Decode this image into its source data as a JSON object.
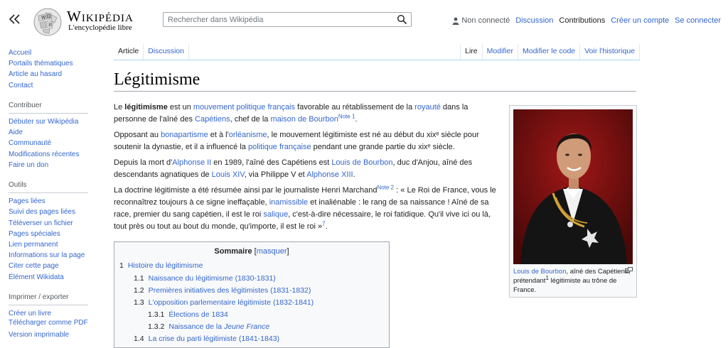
{
  "header": {
    "logo_wordmark": "Wikipédia",
    "logo_tagline": "L'encyclopédie libre",
    "search_placeholder": "Rechercher dans Wikipédia",
    "user_links": [
      "Non connecté",
      "Discussion",
      "Contributions",
      "Créer un compte",
      "Se connecter"
    ]
  },
  "sidebar": {
    "nav": [
      "Accueil",
      "Portails thématiques",
      "Article au hasard",
      "Contact"
    ],
    "sections": [
      {
        "heading": "Contribuer",
        "items": [
          "Débuter sur Wikipédia",
          "Aide",
          "Communauté",
          "Modifications récentes",
          "Faire un don"
        ]
      },
      {
        "heading": "Outils",
        "items": [
          "Pages liées",
          "Suivi des pages liées",
          "Téléverser un fichier",
          "Pages spéciales",
          "Lien permanent",
          "Informations sur la page",
          "Citer cette page",
          "Élément Wikidata"
        ]
      },
      {
        "heading": "Imprimer / exporter",
        "items": [
          "Créer un livre",
          "Télécharger comme PDF",
          "Version imprimable"
        ]
      }
    ]
  },
  "tabs": {
    "left": [
      "Article",
      "Discussion"
    ],
    "right": [
      "Lire",
      "Modifier",
      "Modifier le code",
      "Voir l'historique"
    ]
  },
  "article": {
    "title": "Légitimisme",
    "p1": {
      "t0": "Le ",
      "b": "légitimisme",
      "t1": " est un ",
      "l1": "mouvement politique",
      "t2": " ",
      "l2": "français",
      "t3": " favorable au rétablissement de la ",
      "l3": "royauté",
      "t4": " dans la personne de l'aîné des ",
      "l4": "Capétiens",
      "t5": ", chef de la ",
      "l5": "maison de Bourbon",
      "n": "Note 1",
      "t6": "."
    },
    "p2": {
      "t0": "Opposant au ",
      "l1": "bonapartisme",
      "t1": " et à l'",
      "l2": "orléanisme",
      "t2": ", le mouvement légitimiste est né au début du xixᵉ siècle pour soutenir la dynastie, et il a influencé la ",
      "l3": "politique française",
      "t3": " pendant une grande partie du xixᵉ siècle."
    },
    "p3": {
      "t0": "Depuis la mort d'",
      "l1": "Alphonse II",
      "t1": " en 1989, l'aîné des Capétiens est ",
      "l2": "Louis de Bourbon",
      "t2": ", duc d'Anjou, aîné des descendants agnatiques de ",
      "l3": "Louis XIV",
      "t3": ", via Philippe V et ",
      "l4": "Alphonse XIII",
      "t4": "."
    },
    "p4": {
      "t0": "La doctrine légitimiste a été résumée ainsi par le journaliste Henri Marchand",
      "n": "Note 2",
      "t1": " : « Le Roi de France, vous le reconnaîtrez toujours à ce signe ineffaçable, ",
      "l1": "inamissible",
      "t2": " et inaliénable : le rang de sa naissance ! Aîné de sa race, premier du sang capétien, il est le roi ",
      "l2": "salique",
      "t3": ", c'est-à-dire nécessaire, le roi fatidique. Qu'il vive ici ou là, tout près ou tout au bout du monde, qu'importe, il est le roi »",
      "r": "7",
      "t4": "."
    }
  },
  "infobox": {
    "caption_link": "Louis de Bourbon",
    "caption_t1": ", aîné des Capétiens, prétendant",
    "caption_sup": "1",
    "caption_t2": " légitimiste au trône de France."
  },
  "toc": {
    "title": "Sommaire",
    "toggle": "masquer",
    "entries": [
      {
        "num": "1",
        "text": "Histoire du légitimisme"
      },
      {
        "num": "1.1",
        "text": "Naissance du légitimisme (1830-1831)"
      },
      {
        "num": "1.2",
        "text": "Premières initiatives des légitimistes (1831-1832)"
      },
      {
        "num": "1.3",
        "text": "L'opposition parlementaire légitimiste (1832-1841)"
      },
      {
        "num": "1.3.1",
        "text": "Élections de 1834"
      },
      {
        "num": "1.3.2",
        "text_pre": "Naissance de la ",
        "text_em": "Jeune France"
      },
      {
        "num": "1.4",
        "text": "La crise du parti légitimiste (1841-1843)"
      }
    ]
  }
}
